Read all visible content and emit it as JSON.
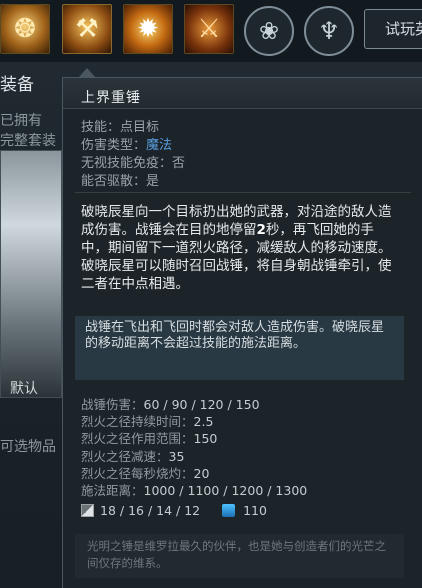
{
  "background": {
    "ability_icons": [
      "ability-1-icon",
      "ability-2-hammer-icon",
      "ability-3-sun-icon",
      "ability-4-hammer-fire-icon"
    ],
    "talent_icons": [
      "talent-tree-icon",
      "aghanim-icon"
    ],
    "try_button_label": "试玩英",
    "equip_title": "装备",
    "owned_text": "已拥有",
    "collected_text": "完整套装",
    "default_label": "默认",
    "optional_label": "可选物品"
  },
  "tooltip": {
    "title": "上界重锤",
    "stats": {
      "ability_label": "技能：",
      "ability_value": "点目标",
      "damage_type_label": "伤害类型：",
      "damage_type_value": "魔法",
      "immunity_label": "无视技能免疫：",
      "immunity_value": "否",
      "dispel_label": "能否驱散：",
      "dispel_value": "是"
    },
    "description": {
      "part1": "破晓辰星向一个目标扔出她的武器，对沿途的敌人造成伤害。战锤会在目的地停留",
      "bold": "2",
      "part2": "秒，再飞回她的手中，期间留下一道烈火路径，减缓敌人的移动速度。破晓辰星可以随时召回战锤，将自身朝战锤牵引，使二者在中点相遇。"
    },
    "notes": "战锤在飞出和飞回时都会对敌人造成伤害。破晓辰星的移动距离不会超过技能的施法距离。",
    "values": [
      {
        "label": "战锤伤害：",
        "value": "60 / 90 / 120 / 150"
      },
      {
        "label": "烈火之径持续时间：",
        "value": "2.5"
      },
      {
        "label": "烈火之径作用范围：",
        "value": "150"
      },
      {
        "label": "烈火之径减速：",
        "value": "35"
      },
      {
        "label": "烈火之径每秒烧灼：",
        "value": "20"
      },
      {
        "label": "施法距离：",
        "value": "1000 / 1100 / 1200 / 1300"
      }
    ],
    "cooldown": "18 / 16 / 14 / 12",
    "mana_cost": "110",
    "lore": "光明之锤是维罗拉最久的伙伴，也是她与创造者们的光芒之间仅存的维系。",
    "accent_color": "#5a9ee0"
  }
}
